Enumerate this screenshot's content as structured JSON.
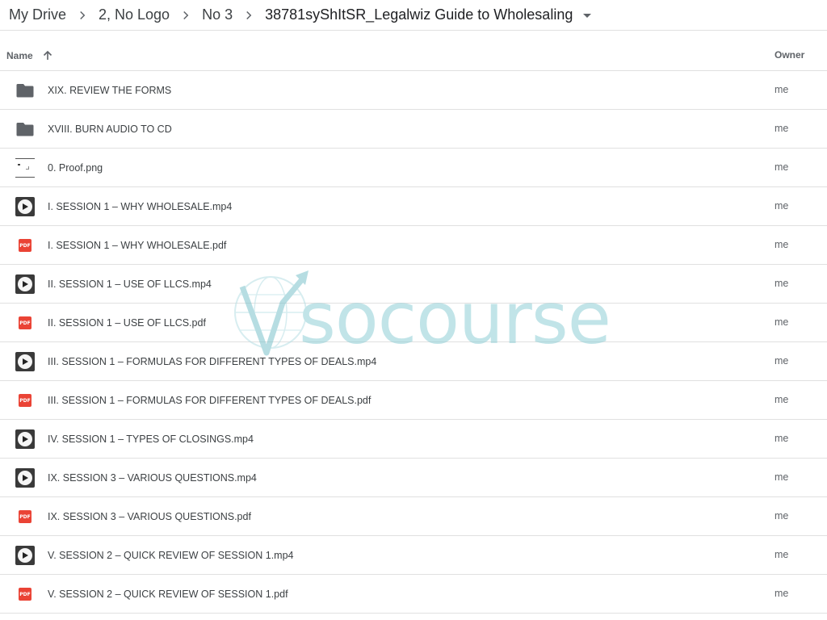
{
  "breadcrumb": {
    "items": [
      "My Drive",
      "2, No Logo",
      "No 3",
      "38781syShItSR_Legalwiz Guide to Wholesaling"
    ]
  },
  "header": {
    "name_label": "Name",
    "owner_label": "Owner"
  },
  "files": [
    {
      "name": "XIX. REVIEW THE FORMS",
      "type": "folder",
      "owner": "me"
    },
    {
      "name": "XVIII. BURN AUDIO TO CD",
      "type": "folder",
      "owner": "me"
    },
    {
      "name": "0. Proof.png",
      "type": "image",
      "owner": "me"
    },
    {
      "name": "I. SESSION 1 – WHY WHOLESALE.mp4",
      "type": "video",
      "owner": "me"
    },
    {
      "name": "I. SESSION 1 – WHY WHOLESALE.pdf",
      "type": "pdf",
      "owner": "me"
    },
    {
      "name": "II. SESSION 1 – USE OF LLCS.mp4",
      "type": "video",
      "owner": "me"
    },
    {
      "name": "II. SESSION 1 – USE OF LLCS.pdf",
      "type": "pdf",
      "owner": "me"
    },
    {
      "name": "III. SESSION 1 – FORMULAS FOR DIFFERENT TYPES OF DEALS.mp4",
      "type": "video",
      "owner": "me"
    },
    {
      "name": "III. SESSION 1 – FORMULAS FOR DIFFERENT TYPES OF DEALS.pdf",
      "type": "pdf",
      "owner": "me"
    },
    {
      "name": "IV. SESSION 1 – TYPES OF CLOSINGS.mp4",
      "type": "video",
      "owner": "me"
    },
    {
      "name": "IX. SESSION 3 – VARIOUS QUESTIONS.mp4",
      "type": "video",
      "owner": "me"
    },
    {
      "name": "IX. SESSION 3 – VARIOUS QUESTIONS.pdf",
      "type": "pdf",
      "owner": "me"
    },
    {
      "name": "V. SESSION 2 – QUICK REVIEW OF SESSION 1.mp4",
      "type": "video",
      "owner": "me"
    },
    {
      "name": "V. SESSION 2 – QUICK REVIEW OF SESSION 1.pdf",
      "type": "pdf",
      "owner": "me"
    }
  ],
  "pdf_badge": "PDF",
  "watermark": {
    "text": "socourse",
    "logo_letter": "W"
  },
  "colors": {
    "pdf": "#ea4335",
    "folder": "#5f6368",
    "watermark": "#8fcfd6",
    "divider": "#e0e0e0"
  },
  "icons": {
    "breadcrumb_separator": "chevron-right-icon",
    "breadcrumb_menu": "caret-down-icon",
    "sort": "arrow-up-icon",
    "folder": "folder-icon",
    "video": "video-play-icon",
    "pdf": "pdf-icon",
    "image": "image-thumbnail-icon"
  }
}
